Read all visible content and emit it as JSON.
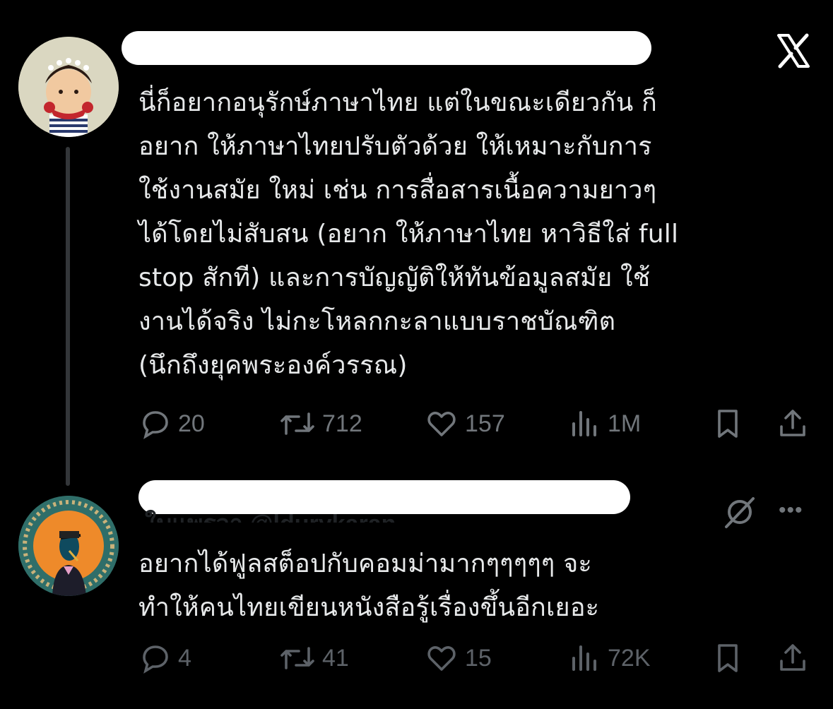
{
  "header": {
    "close_icon": "x-logo-icon"
  },
  "tweet1": {
    "text": "นี่ก็อยากอนุรักษ์ภาษาไทย แต่ในขณะเดียวกัน ก็\nอยาก ให้ภาษาไทยปรับตัวด้วย  ให้เหมาะกับการ\nใช้งานสมัย ใหม่ เช่น การสื่อสารเนื้อความยาวๆ\nได้โดยไม่สับสน (อยาก ให้ภาษาไทย หาวิธีใส่ full\nstop สักที) และการบัญญัติให้ทันข้อมูลสมัย ใช้\nงานได้จริง ไม่กะโหลกกะลาแบบราชบัณฑิต\n(นึกถึงยุคพระองค์วรรณ)",
    "replies": "20",
    "reposts": "712",
    "likes": "157",
    "views": "1M"
  },
  "tweet2": {
    "handle_partial": "ใบแพรวา  @ldurykaran",
    "text": "อยากได้ฟูลสต็อปกับคอมม่ามากๆๆๆๆๆ จะ\nทำให้คนไทยเขียนหนังสือรู้เรื่องขึ้นอีกเยอะ",
    "replies": "4",
    "reposts": "41",
    "likes": "15",
    "views": "72K",
    "more": "•••"
  },
  "colors": {
    "background": "#000000",
    "text": "#e7e9ea",
    "muted": "#71767b"
  }
}
